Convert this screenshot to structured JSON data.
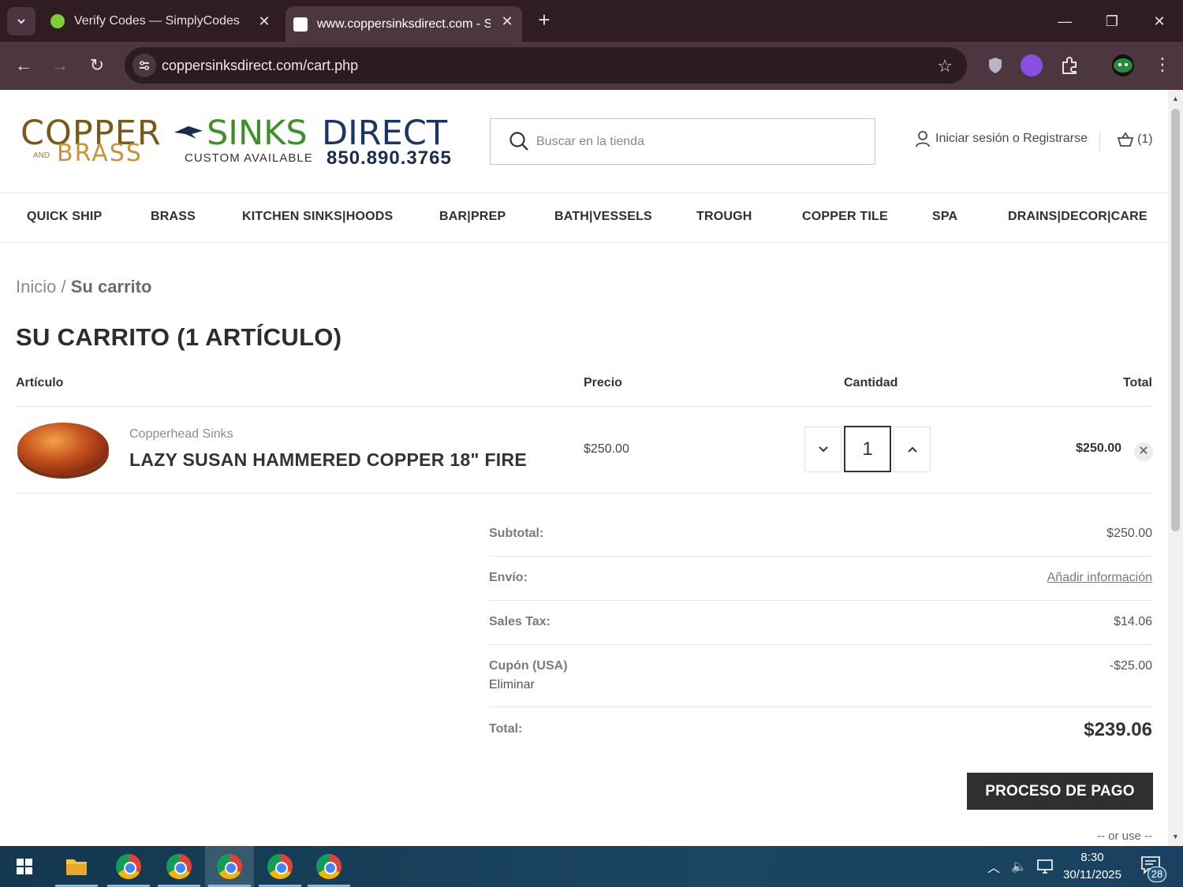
{
  "browser": {
    "tabs": [
      {
        "title": "Verify Codes — SimplyCodes",
        "favicon": "simplycodes-icon"
      },
      {
        "title": "www.coppersinksdirect.com - Si",
        "favicon": "coppersinks-icon"
      }
    ],
    "url": "coppersinksdirect.com/cart.php"
  },
  "site": {
    "logo": {
      "copper": "COPPER",
      "sinks": "SINKS",
      "direct": "DIRECT",
      "and": "AND",
      "brass": "BRASS",
      "custom": "CUSTOM AVAILABLE",
      "phone": "850.890.3765"
    },
    "search_placeholder": "Buscar en la tienda",
    "account_label": "Iniciar sesión o Registrarse",
    "cart_count": "(1)",
    "nav": [
      "QUICK SHIP",
      "BRASS",
      "KITCHEN SINKS|HOODS",
      "BAR|PREP",
      "BATH|VESSELS",
      "TROUGH",
      "COPPER TILE",
      "SPA",
      "DRAINS|DECOR|CARE"
    ]
  },
  "cart": {
    "breadcrumb": {
      "home": "Inicio",
      "sep": "/",
      "current": "Su carrito"
    },
    "title": "SU CARRITO (1 ARTÍCULO)",
    "headers": {
      "item": "Artículo",
      "price": "Precio",
      "qty": "Cantidad",
      "total": "Total"
    },
    "item": {
      "brand": "Copperhead Sinks",
      "name": "LAZY SUSAN HAMMERED COPPER 18\" FIRE",
      "price": "$250.00",
      "qty": "1",
      "total": "$250.00"
    },
    "summary": {
      "subtotal_label": "Subtotal:",
      "subtotal_value": "$250.00",
      "shipping_label": "Envío:",
      "shipping_value": "Añadir información",
      "tax_label": "Sales Tax:",
      "tax_value": "$14.06",
      "coupon_label": "Cupón (USA)",
      "coupon_value": "-$25.00",
      "coupon_remove": "Eliminar",
      "total_label": "Total:",
      "total_value": "$239.06"
    },
    "checkout_label": "PROCESO DE PAGO",
    "or_use": "-- or use --"
  },
  "taskbar": {
    "time": "8:30",
    "date": "30/11/2025",
    "notifications": "28"
  }
}
